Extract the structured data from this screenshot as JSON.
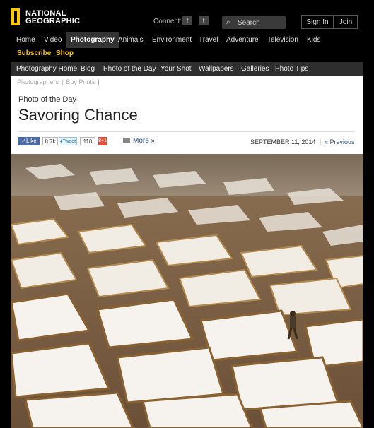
{
  "brand": {
    "line1": "NATIONAL",
    "line2": "GEOGRAPHIC",
    "accent": "#ffc800"
  },
  "header": {
    "connect_label": "Connect:",
    "facebook_icon": "f",
    "twitter_icon": "t",
    "search_placeholder": "Search",
    "sign_in": "Sign In",
    "join": "Join"
  },
  "main_nav": [
    {
      "label": "Home"
    },
    {
      "label": "Video"
    },
    {
      "label": "Photography"
    },
    {
      "label": "Animals"
    },
    {
      "label": "Environment"
    },
    {
      "label": "Travel"
    },
    {
      "label": "Adventure"
    },
    {
      "label": "Television"
    },
    {
      "label": "Kids"
    }
  ],
  "promo_nav": [
    {
      "label": "Subscribe"
    },
    {
      "label": "Shop"
    }
  ],
  "section_nav": [
    {
      "label": "Photography Home"
    },
    {
      "label": "Blog"
    },
    {
      "label": "Photo of the Day"
    },
    {
      "label": "Your Shot"
    },
    {
      "label": "Wallpapers"
    },
    {
      "label": "Galleries"
    },
    {
      "label": "Photo Tips"
    }
  ],
  "sub_links": [
    {
      "label": "Photographers"
    },
    {
      "label": "Buy Prints"
    }
  ],
  "article": {
    "kicker": "Photo of the Day",
    "title": "Savoring Chance",
    "like_label": "Like",
    "like_count": "8.7k",
    "tweet_label": "Tweet",
    "tweet_count": "110",
    "gplus_label": "8+1",
    "more_label": "More »",
    "date": "SEPTEMBER 11, 2014",
    "previous": "« Previous"
  }
}
